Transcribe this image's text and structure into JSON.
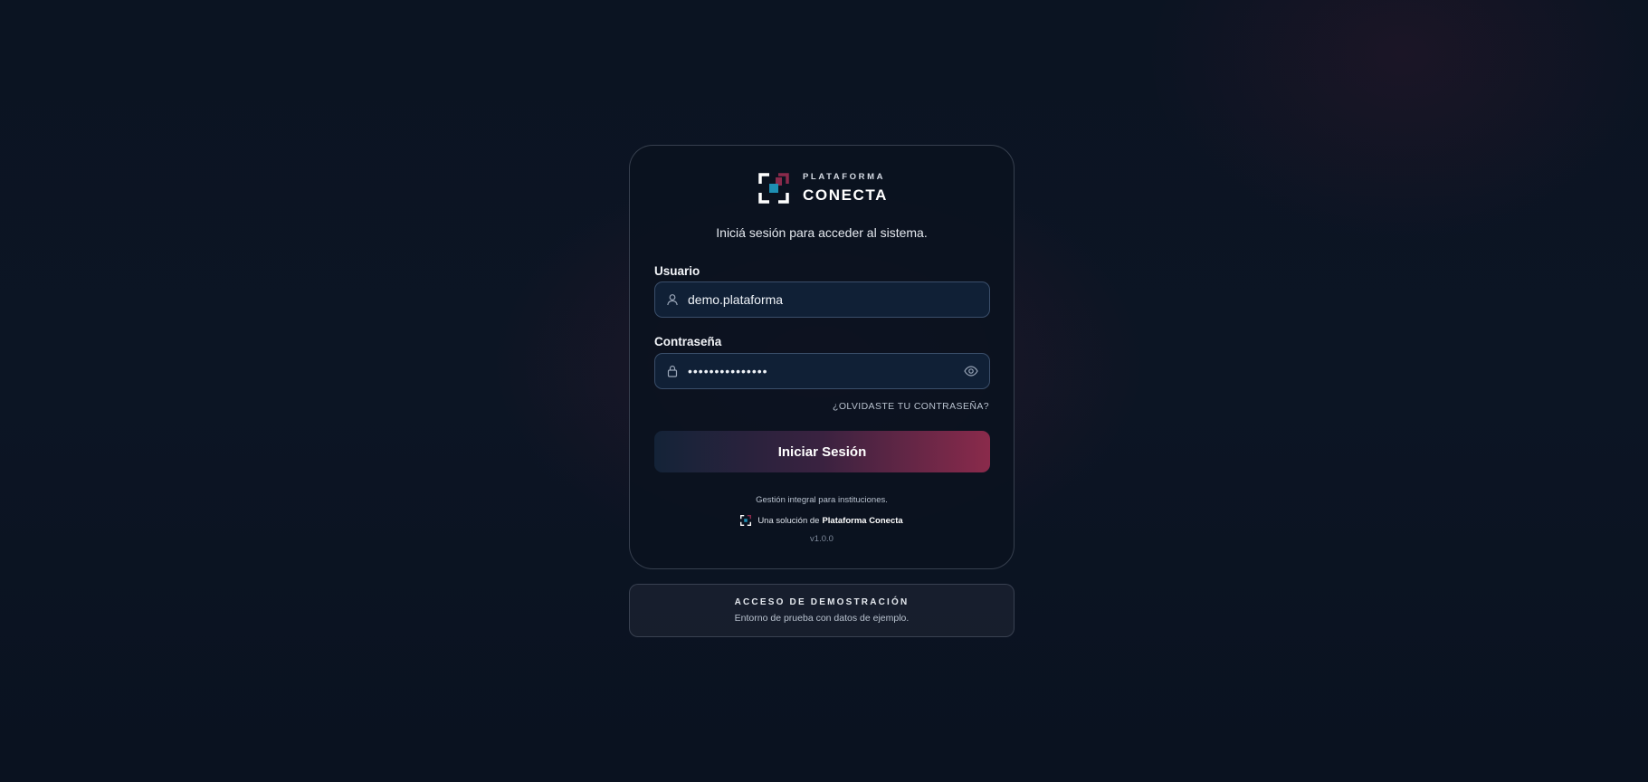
{
  "brand": {
    "top_line": "PLATAFORMA",
    "name": "CONECTA",
    "accent_color": "#8a2a4b",
    "secondary_color": "#1e8fb3"
  },
  "login": {
    "subtitle": "Iniciá sesión para acceder al sistema.",
    "username": {
      "label": "Usuario",
      "value": "demo.plataforma",
      "icon": "user-icon"
    },
    "password": {
      "label": "Contraseña",
      "value": "•••••••••••••••",
      "icon": "lock-icon",
      "toggle_icon": "eye-icon"
    },
    "forgot_link": "¿OLVIDASTE TU CONTRASEÑA?",
    "submit_label": "Iniciar Sesión"
  },
  "footer": {
    "tagline": "Gestión integral para instituciones.",
    "solution_prefix": "Una solución de",
    "solution_brand": "Plataforma Conecta",
    "version": "v1.0.0"
  },
  "demo": {
    "title": "ACCESO DE DEMOSTRACIÓN",
    "description": "Entorno de prueba con datos de ejemplo."
  }
}
